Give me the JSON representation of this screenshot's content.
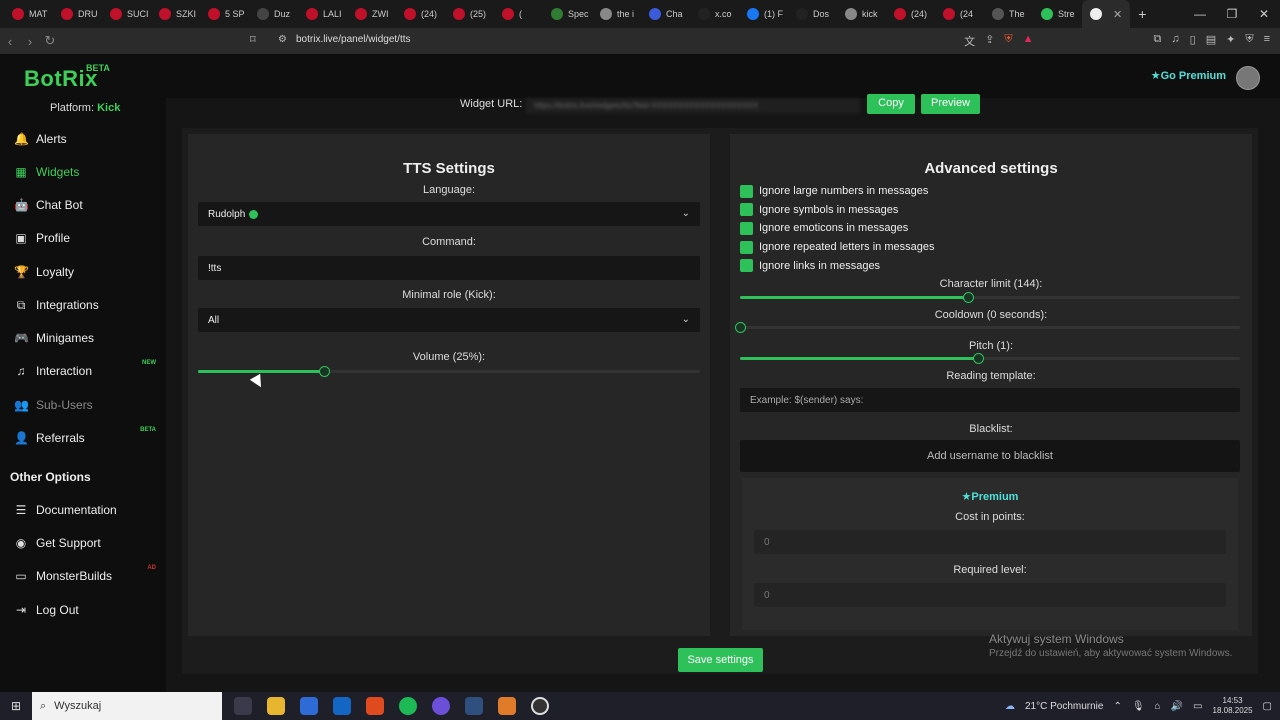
{
  "browser": {
    "tabs": [
      {
        "label": "MAT",
        "color": "#c0102a"
      },
      {
        "label": "DRU",
        "color": "#c0102a"
      },
      {
        "label": "SUCI",
        "color": "#c0102a"
      },
      {
        "label": "SZKI",
        "color": "#c0102a"
      },
      {
        "label": "5 SP",
        "color": "#c0102a"
      },
      {
        "label": "Duz",
        "color": "#444444"
      },
      {
        "label": "LALI",
        "color": "#c0102a"
      },
      {
        "label": "ZWI",
        "color": "#c0102a"
      },
      {
        "label": "(24)",
        "color": "#c0102a"
      },
      {
        "label": "(25)",
        "color": "#c0102a"
      },
      {
        "label": "(",
        "color": "#c0102a"
      },
      {
        "label": "Spec",
        "color": "#2e7d32"
      },
      {
        "label": "the i",
        "color": "#888888"
      },
      {
        "label": "Cha",
        "color": "#3b5bdb"
      },
      {
        "label": "x.co",
        "color": "#222222"
      },
      {
        "label": "(1) F",
        "color": "#1877f2"
      },
      {
        "label": "Dos",
        "color": "#222222"
      },
      {
        "label": "kick",
        "color": "#888888"
      },
      {
        "label": "(24)",
        "color": "#c0102a"
      },
      {
        "label": "(24",
        "color": "#c0102a"
      },
      {
        "label": "The",
        "color": "#555555"
      },
      {
        "label": "Stre",
        "color": "#2ec15a"
      }
    ],
    "url": "botrix.live/panel/widget/tts"
  },
  "header": {
    "logo": "BotRix",
    "logo_badge": "BETA",
    "premium_label": "Go Premium"
  },
  "sidebar": {
    "platform_label": "Platform:",
    "platform_value": "Kick",
    "items": [
      {
        "label": "Alerts",
        "icon": "bell-icon",
        "glyph": "🔔"
      },
      {
        "label": "Widgets",
        "icon": "grid-icon",
        "glyph": "▦"
      },
      {
        "label": "Chat Bot",
        "icon": "robot-icon",
        "glyph": "🤖"
      },
      {
        "label": "Profile",
        "icon": "id-card-icon",
        "glyph": "▣"
      },
      {
        "label": "Loyalty",
        "icon": "trophy-icon",
        "glyph": "🏆"
      },
      {
        "label": "Integrations",
        "icon": "plug-icon",
        "glyph": "⧉"
      },
      {
        "label": "Minigames",
        "icon": "gamepad-icon",
        "glyph": "🎮"
      },
      {
        "label": "Interaction",
        "icon": "music-icon",
        "glyph": "♫",
        "badge": "NEW"
      },
      {
        "label": "Sub-Users",
        "icon": "users-icon",
        "glyph": "👥"
      },
      {
        "label": "Referrals",
        "icon": "user-plus-icon",
        "glyph": "👤",
        "badge": "BETA"
      }
    ],
    "other_title": "Other Options",
    "other_items": [
      {
        "label": "Documentation",
        "icon": "book-icon",
        "glyph": "☰"
      },
      {
        "label": "Get Support",
        "icon": "support-icon",
        "glyph": "◉"
      },
      {
        "label": "MonsterBuilds",
        "icon": "monitor-icon",
        "glyph": "▭",
        "badge": "AD"
      },
      {
        "label": "Log Out",
        "icon": "logout-icon",
        "glyph": "⇥"
      }
    ]
  },
  "widget": {
    "url_label": "Widget URL:",
    "url_value": "https://botrix.live/widgets/tts?bid=XXXXXXXXXXXXXXXXXXXX",
    "copy_label": "Copy",
    "preview_label": "Preview"
  },
  "tts": {
    "title": "TTS Settings",
    "language_label": "Language:",
    "language_value": "Rudolph",
    "command_label": "Command:",
    "command_value": "!tts",
    "role_label": "Minimal role (Kick):",
    "role_value": "All",
    "volume_label": "Volume (25%):",
    "volume": 25
  },
  "advanced": {
    "title": "Advanced settings",
    "checks": [
      "Ignore large numbers in messages",
      "Ignore symbols in messages",
      "Ignore emoticons in messages",
      "Ignore repeated letters in messages",
      "Ignore links in messages"
    ],
    "char_limit_label": "Character limit (144):",
    "char_limit_fraction": 0.455,
    "cooldown_label": "Cooldown (0 seconds):",
    "cooldown_fraction": 0,
    "pitch_label": "Pitch (1):",
    "pitch_fraction": 0.475,
    "template_label": "Reading template:",
    "template_placeholder": "Example: $(sender) says:",
    "blacklist_label": "Blacklist:",
    "blacklist_button": "Add username to blacklist",
    "premium_label": "Premium",
    "cost_label": "Cost in points:",
    "cost_value": "0",
    "level_label": "Required level:",
    "level_value": "0"
  },
  "save_label": "Save settings",
  "os": {
    "watermark_title": "Aktywuj system Windows",
    "watermark_sub": "Przejdź do ustawień, aby aktywować system Windows.",
    "search_placeholder": "Wyszukaj",
    "weather": "21°C Pochmurnie",
    "time": "14:53",
    "date": "18.08.2025"
  }
}
